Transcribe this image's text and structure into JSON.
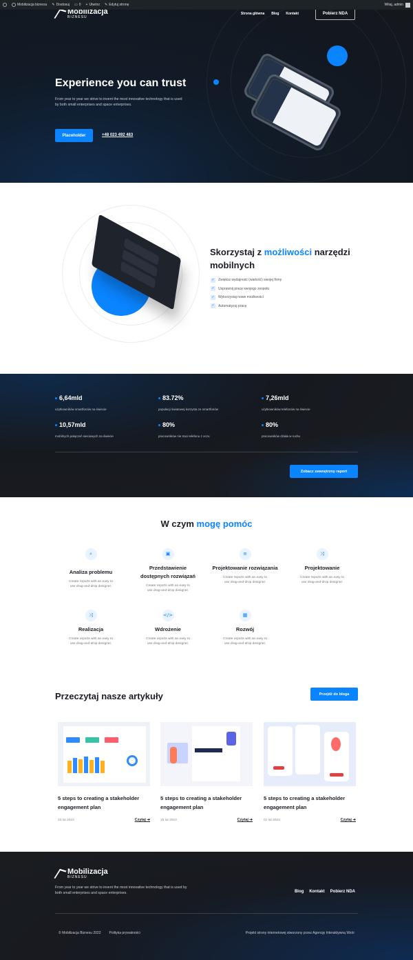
{
  "adminbar": {
    "site": "Mobilizacja biznesu",
    "customize": "Dostosuj",
    "comments": "0",
    "new": "Utwórz",
    "edit": "Edytuj stronę",
    "user": "Witaj, admin"
  },
  "brand": {
    "name": "Mobilizacja",
    "sub": "BIZNESU"
  },
  "nav": {
    "home": "Strona główna",
    "blog": "Blog",
    "contact": "Kontakt",
    "nda": "Pobierz NDA"
  },
  "hero": {
    "title": "Experience you can trust",
    "desc": "From year to year we strive to invent the most innovative technology that is used by both small enterprises and space enterprises.",
    "button": "Placeholder",
    "phone": "+48 023 492 483"
  },
  "mobile": {
    "title_pre": "Skorzystaj z ",
    "title_accent": "możliwości",
    "title_post": " narzędzi mobilnych",
    "items": [
      "Zwiększ wydajność (wartość) swojej firmy",
      "Usprawnij pracę swojego zespołu",
      "Wykorzystaj nowe możliwości",
      "Automatyzuj pracę"
    ]
  },
  "stats": {
    "items": [
      {
        "value": "6,64mld",
        "label": "użytkowników smartfonów na świecie"
      },
      {
        "value": "83.72%",
        "label": "populacji światowej korzysta ze smartfonów"
      },
      {
        "value": "7,26mld",
        "label": "użytkowników telefonów na świecie"
      },
      {
        "value": "10,57mld",
        "label": "mobilnych połączeń sieciowych na świecie"
      },
      {
        "value": "80%",
        "label": "pracowników nie traci telefonu z oczu"
      },
      {
        "value": "80%",
        "label": "pracowników działa w ruchu"
      }
    ],
    "report_button": "Zobacz zewnętrzny raport"
  },
  "services": {
    "title_pre": "W czym ",
    "title_accent": "mogę pomóc",
    "desc": "Create reports with an easy to use drag-and-drop designer.",
    "items": [
      {
        "name": "Analiza problemu",
        "icon": "search-doc-icon"
      },
      {
        "name": "Przedstawienie dostępnych rozwiązań",
        "icon": "image-edit-icon"
      },
      {
        "name": "Projektowanie rozwiązania",
        "icon": "list-sort-icon"
      },
      {
        "name": "Projektowanie",
        "icon": "flow-icon"
      },
      {
        "name": "Realizacja",
        "icon": "branch-icon"
      },
      {
        "name": "Wdrożenie",
        "icon": "code-icon"
      },
      {
        "name": "Rozwój",
        "icon": "grid-icon"
      }
    ]
  },
  "articles": {
    "title": "Przeczytaj nasze artykuły",
    "blog_button": "Przejdź do bloga",
    "items": [
      {
        "title": "5 steps to creating a stakeholder engagement plan",
        "date": "23 lut 2023",
        "read": "Czytaj"
      },
      {
        "title": "5 steps to creating a stakeholder engagement plan",
        "date": "15 lut 2023",
        "read": "Czytaj"
      },
      {
        "title": "5 steps to creating a stakeholder engagement plan",
        "date": "01 lut 2023",
        "read": "Czytaj"
      }
    ]
  },
  "footer": {
    "desc": "From year to year we strive to invent the most innovative technology that is used by both small enterprises and space enterprises.",
    "nav": {
      "blog": "Blog",
      "contact": "Kontakt",
      "nda": "Pobierz NDA"
    },
    "copyright": "© Mobilizacja Biznesu 2022",
    "privacy": "Polityka prywatności",
    "credit": "Projekt strony internetowej stworzony przez Agencję Interaktywną Wzór"
  },
  "colors": {
    "accent": "#0a84ff",
    "dark": "#1b1d21"
  }
}
